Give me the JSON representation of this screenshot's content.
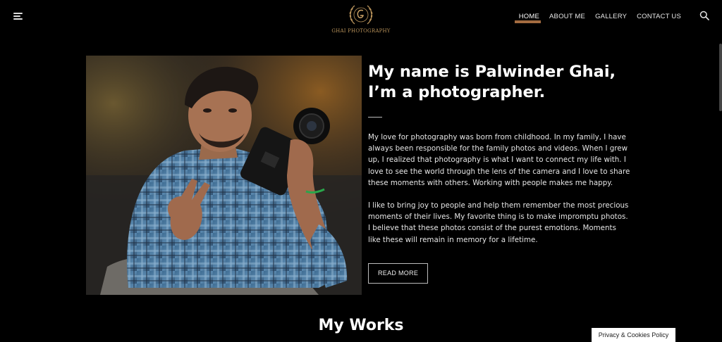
{
  "header": {
    "logo_text": "GHAI PHOTOGRAPHY",
    "nav": [
      {
        "label": "HOME"
      },
      {
        "label": "ABOUT ME"
      },
      {
        "label": "GALLERY"
      },
      {
        "label": "CONTACT US"
      }
    ],
    "active_nav": "HOME",
    "menu_icon": "hamburger-menu-icon",
    "search_icon": "search-icon"
  },
  "hero": {
    "title_line1": "My name is Palwinder Ghai,",
    "title_line2": "I’m a photographer.",
    "paragraph1": "My love for photography was born from childhood. In my family, I have always been responsible for the family photos and videos. When I grew up, I realized that photography is what I want to connect my life with. I love to see the world through the lens of the camera and I love to share these moments with others. Working with people makes me happy.",
    "paragraph2": "I like to bring joy to people and help them remember the most precious moments of their lives. My favorite thing is to make impromptu photos. I believe that these photos consist of the purest emotions. Moments like these will remain in memory for a lifetime.",
    "read_more_label": "READ MORE"
  },
  "works": {
    "title": "My Works"
  },
  "cookie": {
    "label": "Privacy & Cookies Policy"
  },
  "colors": {
    "background": "#000000",
    "accent": "#b57747",
    "logo_gold": "#b8925a"
  }
}
